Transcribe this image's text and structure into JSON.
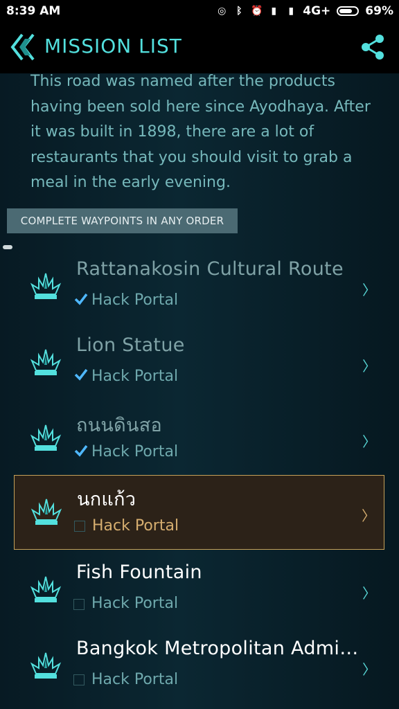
{
  "status_bar": {
    "time": "8:39 AM",
    "network": "4G+",
    "battery": "69%"
  },
  "header": {
    "title": "MISSION LIST"
  },
  "description": "This road was named after the products having been sold here since Ayodhaya. After it was built in 1898, there are a lot of restaurants that you should visit to grab a meal in the early evening.",
  "order_banner": "COMPLETE WAYPOINTS IN ANY ORDER",
  "waypoints": [
    {
      "name": "Rattanakosin Cultural Route",
      "task": "Hack Portal",
      "completed": true,
      "selected": false
    },
    {
      "name": "Lion Statue",
      "task": "Hack Portal",
      "completed": true,
      "selected": false
    },
    {
      "name": "ถนนดินสอ",
      "task": "Hack Portal",
      "completed": true,
      "selected": false
    },
    {
      "name": "นกแก้ว",
      "task": "Hack Portal",
      "completed": false,
      "selected": true
    },
    {
      "name": "Fish Fountain",
      "task": "Hack Portal",
      "completed": false,
      "selected": false
    },
    {
      "name": "Bangkok Metropolitan Admini...",
      "task": "Hack Portal",
      "completed": false,
      "selected": false
    }
  ],
  "colors": {
    "accent": "#53e0de",
    "selected_border": "#c6a25a",
    "selected_text": "#d6ae6f"
  },
  "icons": {
    "back": "double-chevron-left-icon",
    "share": "share-icon",
    "waypoint": "portal-icon",
    "chevron": "chevron-right-icon"
  }
}
